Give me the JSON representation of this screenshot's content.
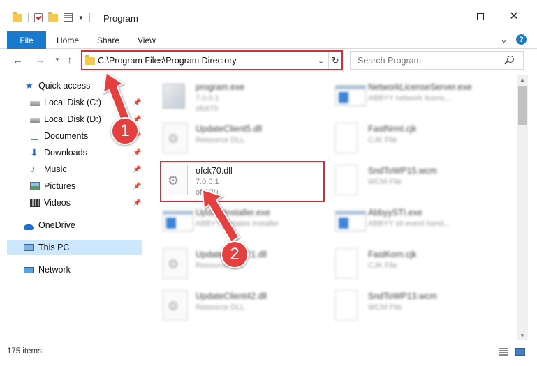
{
  "window": {
    "title": "Program"
  },
  "ribbon": {
    "file": "File",
    "home": "Home",
    "share": "Share",
    "view": "View",
    "help": "?"
  },
  "address": {
    "path": "C:\\Program Files\\Program Directory"
  },
  "search": {
    "placeholder": "Search Program"
  },
  "nav": {
    "quick_access": "Quick access",
    "items": [
      "Local Disk (C:)",
      "Local Disk (D:)",
      "Documents",
      "Downloads",
      "Music",
      "Pictures",
      "Videos"
    ],
    "onedrive": "OneDrive",
    "this_pc": "This PC",
    "network": "Network"
  },
  "files": {
    "left": [
      {
        "name": "program.exe",
        "l2": "7.0.0.1",
        "l3": "ofck70"
      },
      {
        "name": "UpdateClient5.dll",
        "l2": "Resource DLL",
        "l3": ""
      },
      {
        "name": "ofck70.dll",
        "l2": "7.0.0.1",
        "l3": "ofck70"
      },
      {
        "name": "UpdateInstaller.exe",
        "l2": "ABBYY updates installer",
        "l3": ""
      },
      {
        "name": "UpdateClient21.dll",
        "l2": "Resource DLL",
        "l3": ""
      },
      {
        "name": "UpdateClient42.dll",
        "l2": "Resource DLL",
        "l3": ""
      }
    ],
    "right": [
      {
        "name": "NetworkLicenseServer.exe",
        "l2": "ABBYY network licens..."
      },
      {
        "name": "FastNrml.cjk",
        "l2": "CJK File"
      },
      {
        "name": "SndToWP15.wcm",
        "l2": "WCM File"
      },
      {
        "name": "AbbyySTI.exe",
        "l2": "ABBYY sti event hand..."
      },
      {
        "name": "FastKorn.cjk",
        "l2": "CJK File"
      },
      {
        "name": "SndToWP13.wcm",
        "l2": "WCM File"
      }
    ]
  },
  "status": {
    "count": "175 items"
  },
  "annotations": {
    "step1": "1",
    "step2": "2"
  },
  "colors": {
    "accent": "#1979ca",
    "highlight": "#d22f36",
    "badge": "#e5403f",
    "selection": "#cce8ff"
  }
}
